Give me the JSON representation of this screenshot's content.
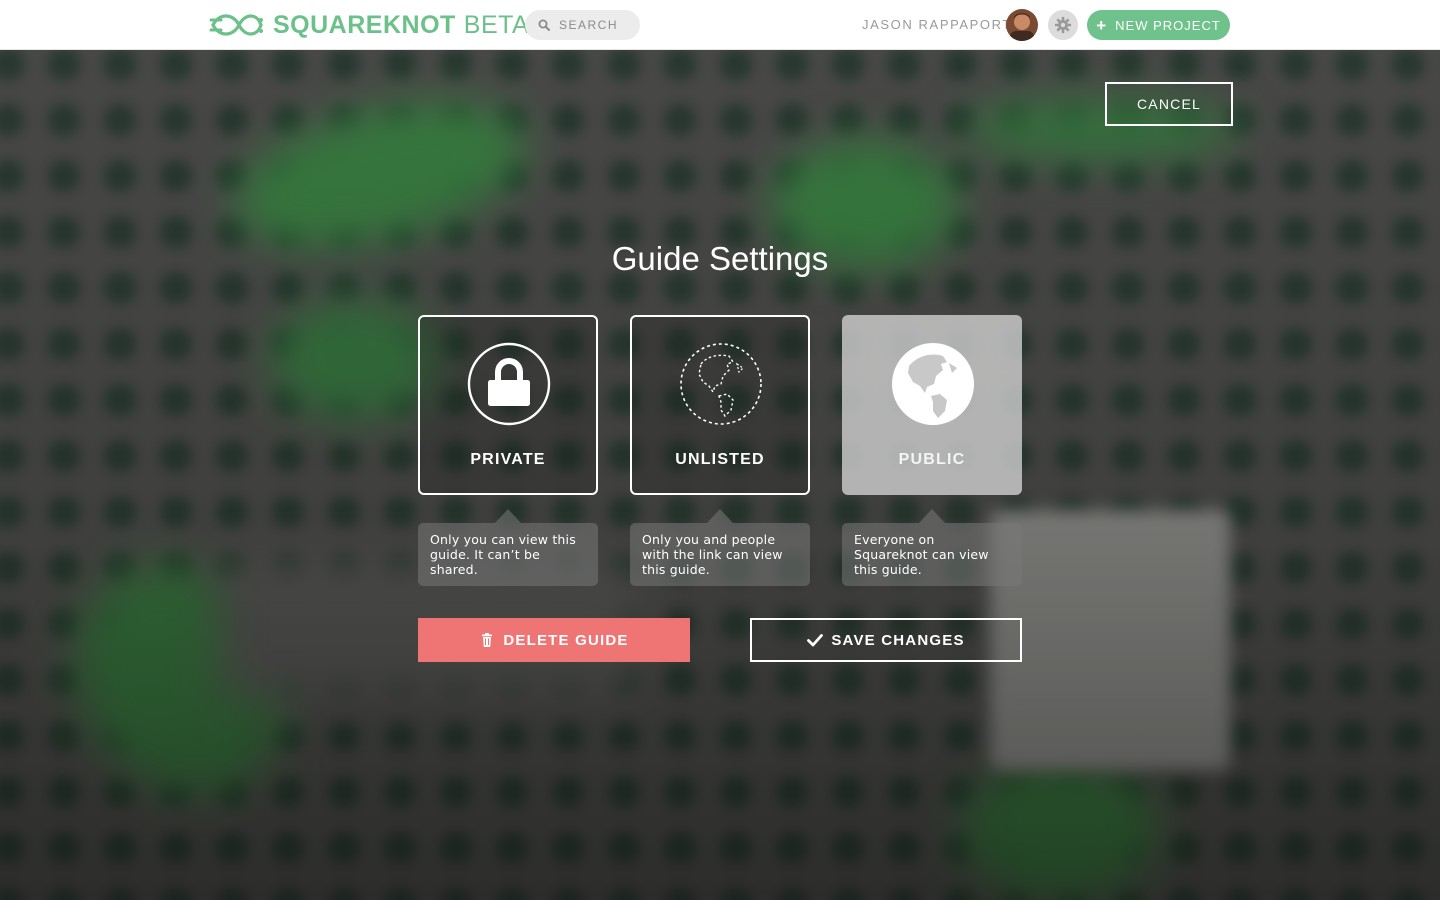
{
  "header": {
    "brand": "SQUAREKNOT",
    "beta": "BETA",
    "search_placeholder": "SEARCH",
    "username": "JASON RAPPAPORT",
    "new_project_label": "NEW PROJECT"
  },
  "modal": {
    "cancel_label": "CANCEL",
    "title": "Guide Settings",
    "options": [
      {
        "label": "PRIVATE",
        "icon": "lock-icon",
        "description": "Only you can view this guide. It can’t be shared.",
        "selected": false
      },
      {
        "label": "UNLISTED",
        "icon": "dashed-globe-icon",
        "description": "Only you and people with the link can view this guide.",
        "selected": false
      },
      {
        "label": "PUBLIC",
        "icon": "globe-icon",
        "description": "Everyone on Squareknot can view this guide.",
        "selected": true
      }
    ],
    "delete_label": "DELETE GUIDE",
    "save_label": "SAVE CHANGES"
  },
  "colors": {
    "brand_green": "#6cc18a",
    "delete_red": "#ef7574",
    "white": "#ffffff"
  }
}
